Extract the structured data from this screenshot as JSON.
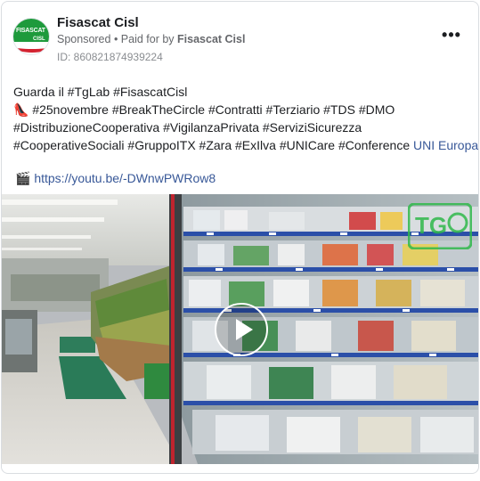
{
  "post": {
    "page_name": "Fisascat Cisl",
    "sponsored_label": "Sponsored",
    "separator": " • ",
    "paid_for_prefix": "Paid for by ",
    "paid_for_by": "Fisascat Cisl",
    "id_text": "ID: 860821874939224",
    "more_label": "•••",
    "avatar_text": "FISASCAT",
    "avatar_subtext": "CISL",
    "lines": [
      "Guarda il #TgLab #FisascatCisl",
      "👠 #25novembre #BreakTheCircle #Contratti #Terziario #TDS #DMO",
      "#DistribuzioneCooperativa #VigilanzaPrivata #ServiziSicurezza",
      "#CooperativeSociali #GruppoITX #Zara #ExIlva #UNICare #Conference "
    ],
    "line4_link": "UNI Europa",
    "link_icon": "🎬",
    "link_url": "https://youtu.be/-DWnwPWRow8"
  },
  "video": {
    "watermark": "TG LAB",
    "play_icon": "play-icon"
  },
  "colors": {
    "link": "#385898",
    "brand_green": "#1e9a3c",
    "brand_red": "#d32230",
    "secondary_text": "#65676b"
  }
}
